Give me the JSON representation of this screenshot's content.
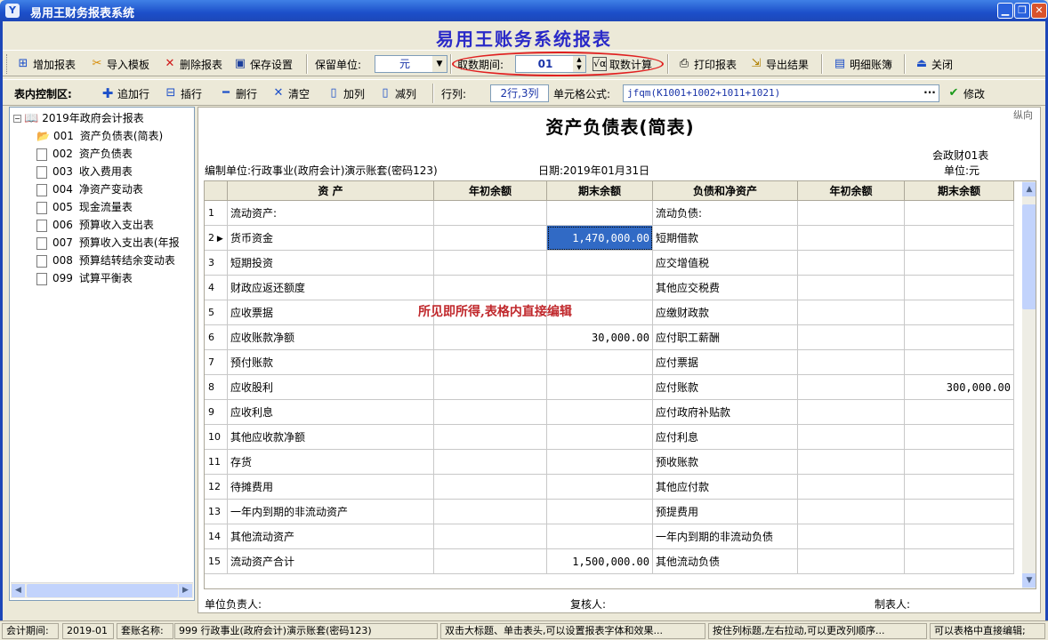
{
  "window": {
    "title": "易用王财务报表系统",
    "app_icon": "Y"
  },
  "banner": {
    "title": "易用王账务系统报表"
  },
  "toolbar": {
    "add_report": "增加报表",
    "import_template": "导入模板",
    "delete_report": "删除报表",
    "save_settings": "保存设置",
    "unit_label": "保留单位:",
    "unit_value": "元",
    "period_label": "取数期间:",
    "period_value": "01",
    "calc": "取数计算",
    "print": "打印报表",
    "export": "导出结果",
    "ledger": "明细账簿",
    "close": "关闭"
  },
  "table_toolbar": {
    "label": "表内控制区:",
    "add_row": "追加行",
    "insert_row": "插行",
    "delete_row": "删行",
    "clear": "清空",
    "add_col": "加列",
    "remove_col": "减列",
    "rowcol_label": "行列:",
    "rowcol_value": "2行,3列",
    "formula_label": "单元格公式:",
    "formula_value": "jfqm(K1001+1002+1011+1021)",
    "modify": "修改"
  },
  "tree": {
    "root": "2019年政府会计报表",
    "items": [
      {
        "code": "001",
        "name": "资产负债表(简表)",
        "open": true
      },
      {
        "code": "002",
        "name": "资产负债表"
      },
      {
        "code": "003",
        "name": "收入费用表"
      },
      {
        "code": "004",
        "name": "净资产变动表"
      },
      {
        "code": "005",
        "name": "现金流量表"
      },
      {
        "code": "006",
        "name": "预算收入支出表"
      },
      {
        "code": "007",
        "name": "预算收入支出表(年报"
      },
      {
        "code": "008",
        "name": "预算结转结余变动表"
      },
      {
        "code": "099",
        "name": "试算平衡表"
      }
    ]
  },
  "report": {
    "corner": "纵向",
    "title": "资产负债表(简表)",
    "form_no": "会政财01表",
    "org": "编制单位:行政事业(政府会计)演示账套(密码123)",
    "date": "日期:2019年01月31日",
    "unit": "单位:元",
    "annotation": "所见即所得,表格内直接编辑",
    "headers": [
      "资  产",
      "年初余额",
      "期末余额",
      "负债和净资产",
      "年初余额",
      "期末余额"
    ],
    "rows": [
      {
        "n": "1",
        "a": "流动资产:",
        "b": "",
        "c": "",
        "d": "流动负债:",
        "e": "",
        "f": ""
      },
      {
        "n": "2",
        "a": "货币资金",
        "b": "",
        "c": "1,470,000.00",
        "d": "短期借款",
        "e": "",
        "f": "",
        "current": true,
        "selected_col": "c"
      },
      {
        "n": "3",
        "a": "短期投资",
        "b": "",
        "c": "",
        "d": "应交增值税",
        "e": "",
        "f": ""
      },
      {
        "n": "4",
        "a": "财政应返还额度",
        "b": "",
        "c": "",
        "d": "其他应交税费",
        "e": "",
        "f": ""
      },
      {
        "n": "5",
        "a": "应收票据",
        "b": "",
        "c": "",
        "d": "应缴财政款",
        "e": "",
        "f": ""
      },
      {
        "n": "6",
        "a": "应收账款净额",
        "b": "",
        "c": "30,000.00",
        "d": "应付职工薪酬",
        "e": "",
        "f": ""
      },
      {
        "n": "7",
        "a": "预付账款",
        "b": "",
        "c": "",
        "d": "应付票据",
        "e": "",
        "f": ""
      },
      {
        "n": "8",
        "a": "应收股利",
        "b": "",
        "c": "",
        "d": "应付账款",
        "e": "",
        "f": "300,000.00"
      },
      {
        "n": "9",
        "a": "应收利息",
        "b": "",
        "c": "",
        "d": "应付政府补贴款",
        "e": "",
        "f": ""
      },
      {
        "n": "10",
        "a": "其他应收款净额",
        "b": "",
        "c": "",
        "d": "应付利息",
        "e": "",
        "f": ""
      },
      {
        "n": "11",
        "a": "存货",
        "b": "",
        "c": "",
        "d": "预收账款",
        "e": "",
        "f": ""
      },
      {
        "n": "12",
        "a": "待摊费用",
        "b": "",
        "c": "",
        "d": "其他应付款",
        "e": "",
        "f": ""
      },
      {
        "n": "13",
        "a": "一年内到期的非流动资产",
        "b": "",
        "c": "",
        "d": "预提费用",
        "e": "",
        "f": ""
      },
      {
        "n": "14",
        "a": "其他流动资产",
        "b": "",
        "c": "",
        "d": "一年内到期的非流动负债",
        "e": "",
        "f": ""
      },
      {
        "n": "15",
        "a": "流动资产合计",
        "b": "",
        "c": "1,500,000.00",
        "d": "其他流动负债",
        "e": "",
        "f": ""
      }
    ],
    "footer": {
      "principal": "单位负责人:",
      "reviewer": "复核人:",
      "preparer": "制表人:"
    }
  },
  "status": {
    "period_label": "会计期间:",
    "period_value": "2019-01",
    "account_label": "套账名称:",
    "account_value": "999 行政事业(政府会计)演示账套(密码123)",
    "hint1": "双击大标题、单击表头,可以设置报表字体和效果...",
    "hint2": "按住列标题,左右拉动,可以更改列顺序...",
    "hint3": "可以表格中直接编辑;"
  },
  "colors": {
    "accent": "#1c4fc9",
    "banner": "#2a2ac8",
    "selection": "#316ac5",
    "annotation": "#c0282c",
    "highlight_ring": "#e02020"
  }
}
